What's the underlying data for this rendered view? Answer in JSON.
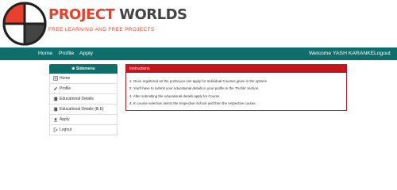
{
  "brand": {
    "name_part1": "PROJECT",
    "name_part2": "WORLDS",
    "tagline": "FREE LEARNING AND FREE PROJECTS",
    "logo_icon": "quadrant-circle-logo",
    "colors": {
      "accent": "#e8402c",
      "dark": "#444444"
    }
  },
  "navbar": {
    "color": "#0f6d6a",
    "home": "Home",
    "profile": "Profile",
    "apply": "Apply",
    "welcome": "Welcome YASH KARANKE",
    "logout": "Logout"
  },
  "sidebar": {
    "header_icon": "plus-circle-icon",
    "header": "Sidemenu",
    "items": [
      {
        "label": "Home",
        "icon": "list-icon"
      },
      {
        "label": "Profile",
        "icon": "pencil-icon"
      },
      {
        "label": "Educational Details",
        "icon": "book-icon"
      },
      {
        "label": "Educational Details (B.E)",
        "icon": "book-icon"
      },
      {
        "label": "Apply",
        "icon": "upload-icon"
      },
      {
        "label": "Logout",
        "icon": "logout-icon"
      }
    ]
  },
  "instructions": {
    "color": "#c4161c",
    "title": "Instructions",
    "items": [
      "1. Once registered on the portal you can apply for Individual Courses given in the options",
      "2. You'll have to submit your educational details in your profile in the 'Profile' section.",
      "3. After submitting the educational details apply for Course.",
      "4. In course selection select the respective School and then the respective course."
    ]
  }
}
